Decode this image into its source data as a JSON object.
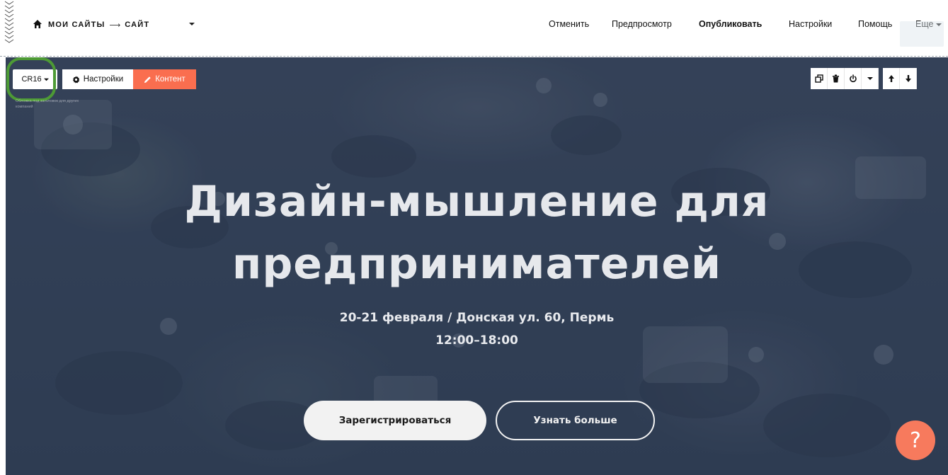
{
  "topbar": {
    "breadcrumb_sites": "МОИ САЙТЫ",
    "breadcrumb_arrow": "⟶",
    "breadcrumb_site": "САЙТ",
    "nav": {
      "cancel": "Отменить",
      "preview": "Предпросмотр",
      "publish": "Опубликовать",
      "settings": "Настройки",
      "help": "Помощь",
      "more": "Еще"
    }
  },
  "block_controls": {
    "code": "CR16",
    "settings": "Настройки",
    "content": "Контент",
    "hint": "Обложка под заголовок для других компаний",
    "content_color": "#fa6e4f",
    "highlight_color": "#4d9a35"
  },
  "hero": {
    "title_line1": "Дизайн-мышление для",
    "title_line2": "предпринимателей",
    "subtitle_line1": "20-21 февраля / Донская ул. 60, Пермь",
    "subtitle_line2": "12:00–18:00",
    "primary_button": "Зарегистрироваться",
    "secondary_button": "Узнать больше"
  },
  "help": {
    "label": "?",
    "color": "#f77a5d"
  },
  "icons": {
    "home": "home-icon",
    "gear": "gear-icon",
    "pencil": "pencil-icon",
    "duplicate": "duplicate-icon",
    "trash": "trash-icon",
    "power": "power-icon",
    "caret": "caret-down-icon",
    "up": "arrow-up-icon",
    "down": "arrow-down-icon"
  }
}
